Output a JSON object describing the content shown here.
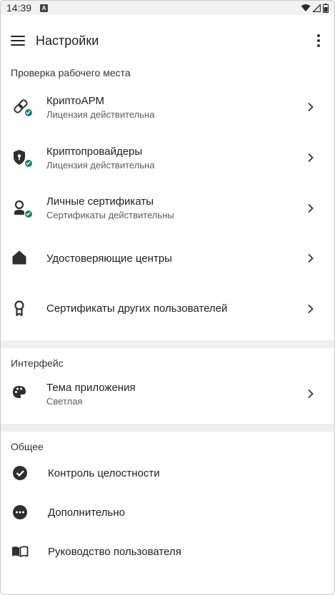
{
  "status": {
    "time": "14:39",
    "app_icon_letter": "A"
  },
  "toolbar": {
    "title": "Настройки"
  },
  "sections": {
    "workplace": {
      "title": "Проверка рабочего места",
      "items": [
        {
          "label": "КриптоАРМ",
          "sublabel": "Лицензия действительна",
          "icon": "cryptoarm-icon"
        },
        {
          "label": "Криптопровайдеры",
          "sublabel": "Лицензия действительна",
          "icon": "shield-key-icon"
        },
        {
          "label": "Личные сертификаты",
          "sublabel": "Сертификаты действительны",
          "icon": "personal-cert-icon"
        },
        {
          "label": "Удостоверяющие центры",
          "icon": "home-icon"
        },
        {
          "label": "Сертификаты других пользователей",
          "icon": "award-icon"
        }
      ]
    },
    "interface": {
      "title": "Интерфейс",
      "items": [
        {
          "label": "Тема приложения",
          "sublabel": "Светлая",
          "icon": "palette-icon"
        }
      ]
    },
    "general": {
      "title": "Общее",
      "items": [
        {
          "label": "Контроль целостности",
          "icon": "check-circle-icon"
        },
        {
          "label": "Дополнительно",
          "icon": "more-circle-icon"
        },
        {
          "label": "Руководство пользователя",
          "icon": "book-icon"
        }
      ]
    }
  },
  "colors": {
    "accent": "#1e7a73",
    "divider": "#efefef",
    "icon": "#2f2f2f"
  }
}
